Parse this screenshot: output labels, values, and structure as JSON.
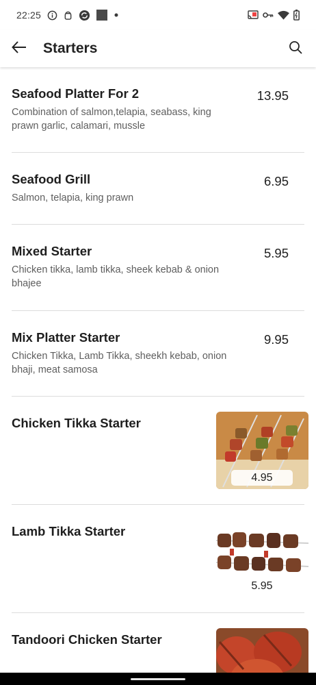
{
  "status_bar": {
    "time": "22:25",
    "icons_left": [
      "info-icon",
      "android-icon",
      "sync-icon",
      "square-icon",
      "dot-icon"
    ],
    "icons_right": [
      "cast-icon",
      "vpn-key-icon",
      "wifi-icon",
      "battery-icon"
    ]
  },
  "app_bar": {
    "title": "Starters",
    "back_icon": "arrow-back-icon",
    "search_icon": "search-icon"
  },
  "items": [
    {
      "name": "Seafood Platter For 2",
      "description": "Combination of salmon,telapia, seabass, king prawn garlic, calamari, mussle",
      "price": "13.95"
    },
    {
      "name": "Seafood Grill",
      "description": "Salmon, telapia, king prawn",
      "price": "6.95"
    },
    {
      "name": "Mixed Starter",
      "description": "Chicken tikka, lamb tikka, sheek kebab & onion bhajee",
      "price": "5.95"
    },
    {
      "name": "Mix Platter Starter",
      "description": "Chicken Tikka, Lamb Tikka, sheekh kebab, onion bhaji, meat samosa",
      "price": "9.95"
    },
    {
      "name": "Chicken Tikka Starter",
      "price": "4.95",
      "image": "chicken-tikka-skewers"
    },
    {
      "name": "Lamb Tikka Starter",
      "price": "5.95",
      "image": "lamb-tikka-skewers"
    },
    {
      "name": "Tandoori Chicken Starter",
      "image": "tandoori-chicken"
    }
  ]
}
